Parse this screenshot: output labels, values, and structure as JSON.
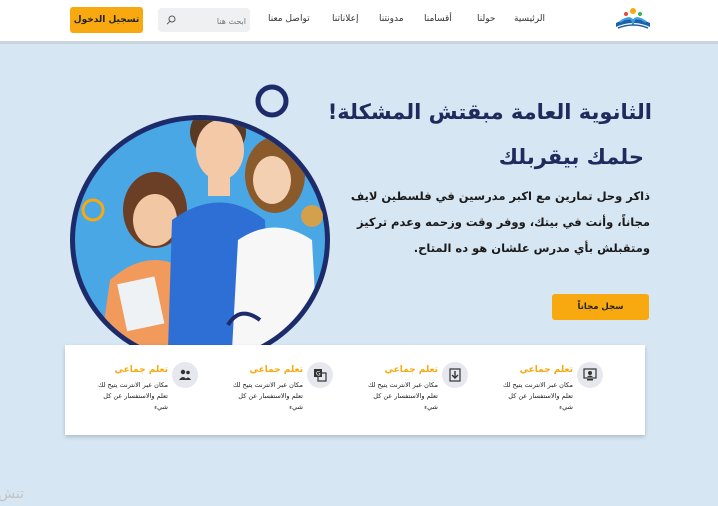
{
  "header": {
    "nav": [
      "الرئيسية",
      "حولنا",
      "أقسامنا",
      "مدونتنا",
      "إعلاناتنا",
      "تواصل معنا"
    ],
    "search_placeholder": "ابحث هنا",
    "login_label": "تسجيل الدخول"
  },
  "hero": {
    "title": "الثانوية العامة مبقتش المشكلة!",
    "subtitle": "حلمك بيقربلك",
    "description": "ذاكر وحل تمارين مع اكبر مدرسين في فلسطين لايف مجاناً، وأنت في بيتك، ووفر وقت وزحمه وعدم تركيز ومتقبلش بأي مدرس علشان هو ده المتاح.",
    "cta_label": "سجل مجاناً"
  },
  "features": [
    {
      "icon": "computer-user-icon",
      "title": "تعلم جماعي",
      "text": "مكان عبر الانترنت يتيح لك تعلم والاستفسار عن كل شيء"
    },
    {
      "icon": "download-icon",
      "title": "تعلم جماعي",
      "text": "مكان عبر الانترنت يتيح لك تعلم والاستفسار عن كل شيء"
    },
    {
      "icon": "translate-icon",
      "title": "تعلم جماعي",
      "text": "مكان عبر الانترنت يتيح لك تعلم والاستفسار عن كل شيء"
    },
    {
      "icon": "group-icon",
      "title": "تعلم جماعي",
      "text": "مكان عبر الانترنت يتيح لك تعلم والاستفسار عن كل شيء"
    }
  ],
  "watermark": "تنش",
  "colors": {
    "accent": "#f8a90f",
    "heading": "#1e2b5c",
    "background": "#d6e6f3",
    "circle": "#1e2b6b"
  }
}
